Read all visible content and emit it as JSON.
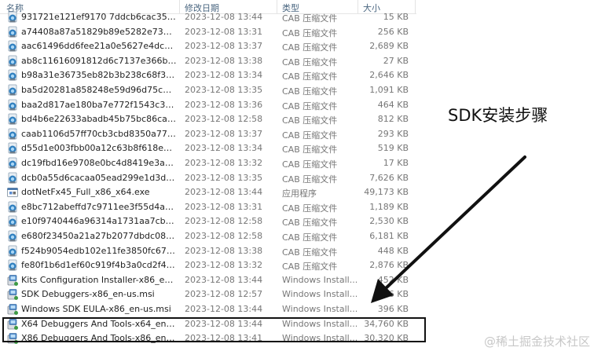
{
  "header": {
    "name": "名称",
    "date": "修改日期",
    "type": "类型",
    "size": "大小"
  },
  "rows": [
    {
      "name": "931721e121ef9170 7ddcb6cac354d9...",
      "date": "2023-12-08 13:44",
      "type": "CAB 压缩文件",
      "size": "15 KB",
      "icon": "cab-icon"
    },
    {
      "name": "a74408a87a51829b89e5282e73974d...",
      "date": "2023-12-08 13:31",
      "type": "CAB 压缩文件",
      "size": "256 KB",
      "icon": "cab-icon"
    },
    {
      "name": "aac61496dd6fee21a0e5627e4dcd84...",
      "date": "2023-12-08 13:37",
      "type": "CAB 压缩文件",
      "size": "2,689 KB",
      "icon": "cab-icon"
    },
    {
      "name": "ab8c11616091812d6c7137e366ba1d...",
      "date": "2023-12-08 13:38",
      "type": "CAB 压缩文件",
      "size": "27 KB",
      "icon": "cab-icon"
    },
    {
      "name": "b98a31e36735eb82b3b238c68f36fb...",
      "date": "2023-12-08 13:34",
      "type": "CAB 压缩文件",
      "size": "2,646 KB",
      "icon": "cab-icon"
    },
    {
      "name": "ba5d20281a858248e59d96d75c014...",
      "date": "2023-12-08 13:35",
      "type": "CAB 压缩文件",
      "size": "1,091 KB",
      "icon": "cab-icon"
    },
    {
      "name": "baa2d817ae180ba7e772f1543c3bbd...",
      "date": "2023-12-08 13:36",
      "type": "CAB 压缩文件",
      "size": "464 KB",
      "icon": "cab-icon"
    },
    {
      "name": "bd4b6e22633abadb45b75bc86caaa...",
      "date": "2023-12-08 12:58",
      "type": "CAB 压缩文件",
      "size": "812 KB",
      "icon": "cab-icon"
    },
    {
      "name": "caab1106d57ff70cb3cbd8350a77e87...",
      "date": "2023-12-08 13:37",
      "type": "CAB 压缩文件",
      "size": "293 KB",
      "icon": "cab-icon"
    },
    {
      "name": "d55d1e003fbb00a12c63b8f618e452...",
      "date": "2023-12-08 13:34",
      "type": "CAB 压缩文件",
      "size": "519 KB",
      "icon": "cab-icon"
    },
    {
      "name": "dc19fbd16e9708e0bc4d8419e3a7d4...",
      "date": "2023-12-08 13:32",
      "type": "CAB 压缩文件",
      "size": "17 KB",
      "icon": "cab-icon"
    },
    {
      "name": "dcb0a55d6cacaa05ead299e1d3de3c...",
      "date": "2023-12-08 13:35",
      "type": "CAB 压缩文件",
      "size": "7,626 KB",
      "icon": "cab-icon"
    },
    {
      "name": "dotNetFx45_Full_x86_x64.exe",
      "date": "2023-12-08 13:44",
      "type": "应用程序",
      "size": "49,173 KB",
      "icon": "exe-icon"
    },
    {
      "name": "e8bc712abeffd7c9711ee3f55d4aa99...",
      "date": "2023-12-08 13:31",
      "type": "CAB 压缩文件",
      "size": "1,189 KB",
      "icon": "cab-icon"
    },
    {
      "name": "e10f9740446a96314a1731aa7cb428...",
      "date": "2023-12-08 12:58",
      "type": "CAB 压缩文件",
      "size": "2,530 KB",
      "icon": "cab-icon"
    },
    {
      "name": "e680f23450a21a27b2077dbdc08ca4...",
      "date": "2023-12-08 12:58",
      "type": "CAB 压缩文件",
      "size": "6,181 KB",
      "icon": "cab-icon"
    },
    {
      "name": "f524b9054edb102e11fe3850fc6796c...",
      "date": "2023-12-08 13:38",
      "type": "CAB 压缩文件",
      "size": "448 KB",
      "icon": "cab-icon"
    },
    {
      "name": "fe80f1b6d1ef60c919f4b3a0cd2f4306...",
      "date": "2023-12-08 13:32",
      "type": "CAB 压缩文件",
      "size": "2,876 KB",
      "icon": "cab-icon"
    },
    {
      "name": "Kits Configuration Installer-x86_en-us...",
      "date": "2023-12-08 13:44",
      "type": "Windows Install...",
      "size": "452 KB",
      "icon": "msi-icon"
    },
    {
      "name": "SDK Debuggers-x86_en-us.msi",
      "date": "2023-12-08 12:57",
      "type": "Windows Install...",
      "size": "636 KB",
      "icon": "msi-icon"
    },
    {
      "name": "Windows SDK EULA-x86_en-us.msi",
      "date": "2023-12-08 13:44",
      "type": "Windows Install...",
      "size": "396 KB",
      "icon": "msi-icon"
    },
    {
      "name": "X64 Debuggers And Tools-x64_en-us...",
      "date": "2023-12-08 13:44",
      "type": "Windows Install...",
      "size": "34,760 KB",
      "icon": "msi-icon"
    },
    {
      "name": "X86 Debuggers And Tools-x86_en-us...",
      "date": "2023-12-08 13:41",
      "type": "Windows Install...",
      "size": "30,320 KB",
      "icon": "msi-icon"
    }
  ],
  "annotation": {
    "text": "SDK安装步骤"
  },
  "watermark": {
    "text": "@稀土掘金技术社区"
  }
}
